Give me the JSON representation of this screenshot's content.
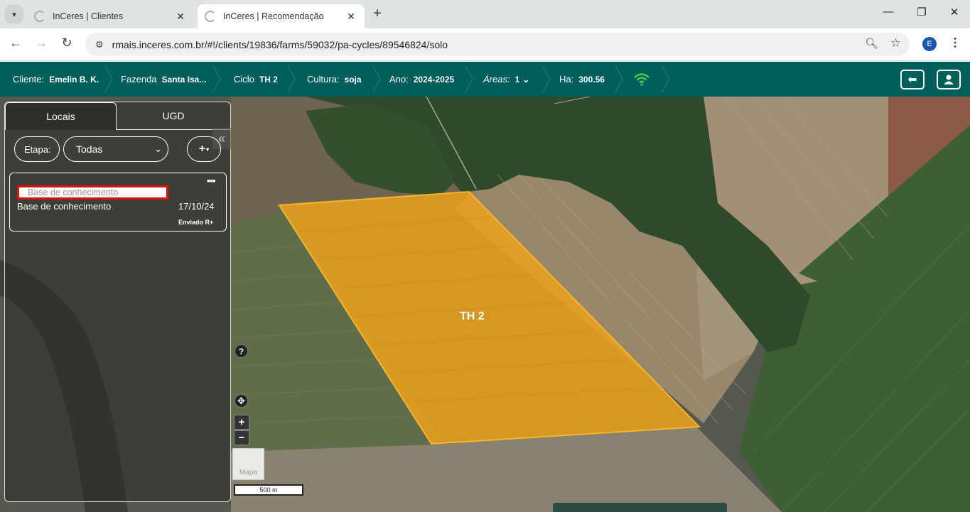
{
  "browser": {
    "tabs": [
      {
        "title": "InCeres | Clientes",
        "active": false
      },
      {
        "title": "InCeres | Recomendação",
        "active": true
      }
    ],
    "url": "rmais.inceres.com.br/#!/clients/19836/farms/59032/pa-cycles/89546824/solo",
    "profile_initial": "E"
  },
  "header": {
    "cliente_label": "Cliente:",
    "cliente_value": "Emelin B. K.",
    "fazenda_label": "Fazenda",
    "fazenda_value": "Santa Isa...",
    "ciclo_label": "Ciclo",
    "ciclo_value": "TH 2",
    "cultura_label": "Cultura:",
    "cultura_value": "soja",
    "ano_label": "Ano:",
    "ano_value": "2024-2025",
    "areas_label": "Áreas:",
    "areas_value": "1",
    "ha_label": "Ha:",
    "ha_value": "300.56",
    "colors": {
      "bar": "#005f5a",
      "wifi": "#3fd24a"
    }
  },
  "panel": {
    "tabs": [
      "Locais",
      "UGD"
    ],
    "etapa_label": "Etapa:",
    "etapa_selected": "Todas",
    "add_button": "+",
    "card": {
      "search_placeholder": "Base de conhecimento",
      "name": "Base de conhecimento",
      "date": "17/10/24",
      "status": "Enviado R+"
    }
  },
  "map": {
    "field_label": "TH 2",
    "layer_label": "Mapa",
    "scale_label": "500 m",
    "field_color": "#e9a11e"
  }
}
